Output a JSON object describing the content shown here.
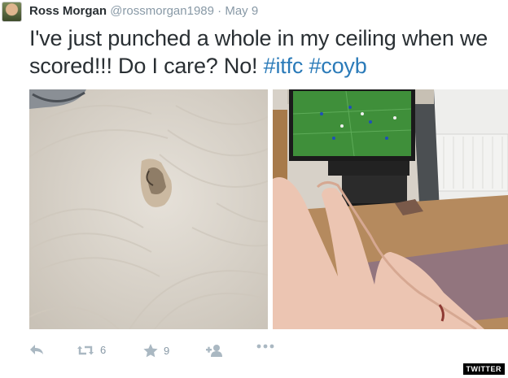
{
  "tweet": {
    "name": "Ross Morgan",
    "handle": "@rossmorgan1989",
    "separator": "·",
    "date": "May 9",
    "text_main": "I've just punched a whole in my ceiling when we scored!!! Do I care? No! ",
    "hashtag1": "#itfc",
    "hashtag2": "#coyb"
  },
  "actions": {
    "retweet_count": "6",
    "favorite_count": "9"
  },
  "logo": "TWITTER",
  "colors": {
    "text": "#292f33",
    "muted": "#8899a6",
    "hashtag": "#2b7bb9"
  },
  "icons": [
    "avatar",
    "reply-icon",
    "retweet-icon",
    "favorite-icon",
    "follow-icon",
    "more-icon"
  ]
}
